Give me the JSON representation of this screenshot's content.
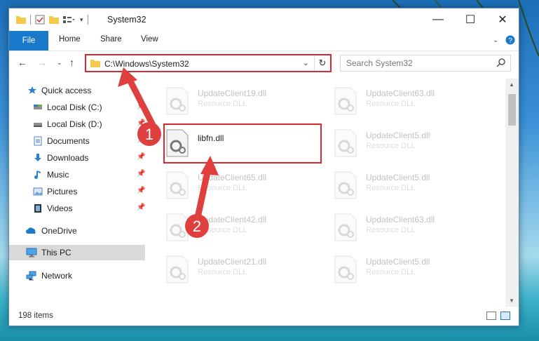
{
  "window": {
    "title": "System32"
  },
  "ribbon": {
    "tabs": [
      "File",
      "Home",
      "Share",
      "View"
    ]
  },
  "address": {
    "path": "C:\\Windows\\System32"
  },
  "search": {
    "placeholder": "Search System32"
  },
  "sidebar": {
    "items": [
      {
        "label": "Quick access",
        "icon": "star-icon",
        "pinned": false
      },
      {
        "label": "Local Disk (C:)",
        "icon": "drive-icon",
        "pinned": true
      },
      {
        "label": "Local Disk (D:)",
        "icon": "drive-icon",
        "pinned": true
      },
      {
        "label": "Documents",
        "icon": "documents-icon",
        "pinned": true
      },
      {
        "label": "Downloads",
        "icon": "download-icon",
        "pinned": true
      },
      {
        "label": "Music",
        "icon": "music-icon",
        "pinned": true
      },
      {
        "label": "Pictures",
        "icon": "pictures-icon",
        "pinned": true
      },
      {
        "label": "Videos",
        "icon": "videos-icon",
        "pinned": true
      },
      {
        "label": "OneDrive",
        "icon": "cloud-icon",
        "pinned": false
      },
      {
        "label": "This PC",
        "icon": "pc-icon",
        "pinned": false,
        "selected": true
      },
      {
        "label": "Network",
        "icon": "network-icon",
        "pinned": false
      }
    ]
  },
  "files": [
    {
      "name": "UpdateClient19.dll",
      "desc": "Resource DLL",
      "faded": true
    },
    {
      "name": "UpdateClient63.dll",
      "desc": "Resource DLL",
      "faded": true
    },
    {
      "name": "libfn.dll",
      "desc": "",
      "faded": false
    },
    {
      "name": "UpdateClient5.dll",
      "desc": "Resource DLL",
      "faded": true
    },
    {
      "name": "UpdateClient65.dll",
      "desc": "Resource DLL",
      "faded": true
    },
    {
      "name": "UpdateClient5.dll",
      "desc": "Resource DLL",
      "faded": true
    },
    {
      "name": "UpdateClient42.dll",
      "desc": "Resource DLL",
      "faded": true
    },
    {
      "name": "UpdateClient63.dll",
      "desc": "Resource DLL",
      "faded": true
    },
    {
      "name": "UpdateClient21.dll",
      "desc": "Resource DLL",
      "faded": true
    },
    {
      "name": "UpdateClient5.dll",
      "desc": "Resource DLL",
      "faded": true
    }
  ],
  "status": {
    "count": "198 items"
  },
  "annotations": {
    "step1": "1",
    "step2": "2"
  },
  "colors": {
    "accent": "#1979ca",
    "highlight": "#d9282f"
  }
}
